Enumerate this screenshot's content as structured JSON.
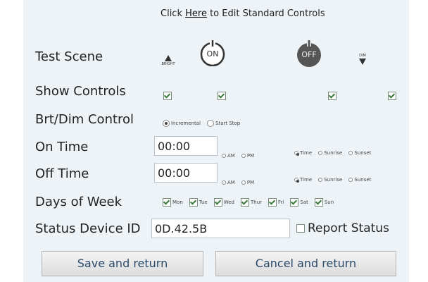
{
  "header": {
    "prefix": "Click ",
    "link_text": "Here",
    "suffix": " to Edit Standard Controls"
  },
  "labels": {
    "test_scene": "Test Scene",
    "show_controls": "Show Controls",
    "brt_dim_control": "Brt/Dim Control",
    "on_time": "On Time",
    "off_time": "Off Time",
    "days_of_week": "Days of Week",
    "status_device_id": "Status Device ID"
  },
  "scene_controls": {
    "bright_label": "BRIGHT",
    "on_label": "ON",
    "off_label": "OFF",
    "dim_label": "DIM"
  },
  "brt_dim": {
    "options": [
      "Incremental",
      "Start Stop"
    ],
    "selected": "Incremental"
  },
  "on_time": {
    "value": "00:00",
    "ampm": [
      "AM",
      "PM"
    ],
    "modes": [
      "Time",
      "Sunrise",
      "Sunset"
    ],
    "selected_mode": "Time"
  },
  "off_time": {
    "value": "00:00",
    "ampm": [
      "AM",
      "PM"
    ],
    "modes": [
      "Time",
      "Sunrise",
      "Sunset"
    ],
    "selected_mode": "Time"
  },
  "days": [
    "Mon",
    "Tue",
    "Wed",
    "Thur",
    "Fri",
    "Sat",
    "Sun"
  ],
  "status": {
    "device_id": "0D.42.5B",
    "report_status_label": "Report Status"
  },
  "buttons": {
    "save": "Save and return",
    "cancel": "Cancel and return"
  },
  "colors": {
    "panel_bg": "#eef3f8",
    "off_button": "#555555",
    "button_text": "#2a4a6a"
  }
}
